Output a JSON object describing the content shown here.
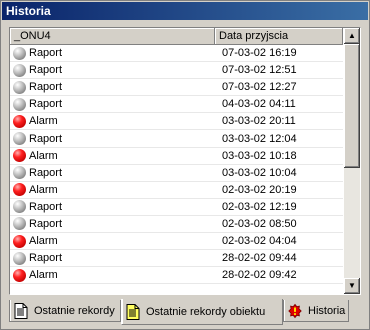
{
  "window": {
    "title": "Historia"
  },
  "columns": [
    "_ONU4",
    "Data przyjscia"
  ],
  "rows": [
    {
      "status": "gray",
      "type": "Raport",
      "date": "07-03-02 16:19"
    },
    {
      "status": "gray",
      "type": "Raport",
      "date": "07-03-02 12:51"
    },
    {
      "status": "gray",
      "type": "Raport",
      "date": "07-03-02 12:27"
    },
    {
      "status": "gray",
      "type": "Raport",
      "date": "04-03-02 04:11"
    },
    {
      "status": "red",
      "type": "Alarm",
      "date": "03-03-02 20:11"
    },
    {
      "status": "gray",
      "type": "Raport",
      "date": "03-03-02 12:04"
    },
    {
      "status": "red",
      "type": "Alarm",
      "date": "03-03-02 10:18"
    },
    {
      "status": "gray",
      "type": "Raport",
      "date": "03-03-02 10:04"
    },
    {
      "status": "red",
      "type": "Alarm",
      "date": "02-03-02 20:19"
    },
    {
      "status": "gray",
      "type": "Raport",
      "date": "02-03-02 12:19"
    },
    {
      "status": "gray",
      "type": "Raport",
      "date": "02-03-02 08:50"
    },
    {
      "status": "red",
      "type": "Alarm",
      "date": "02-03-02 04:04"
    },
    {
      "status": "gray",
      "type": "Raport",
      "date": "28-02-02 09:44"
    },
    {
      "status": "red",
      "type": "Alarm",
      "date": "28-02-02 09:42"
    }
  ],
  "tabs": [
    {
      "label": "Ostatnie rekordy",
      "icon": "document-icon"
    },
    {
      "label": "Ostatnie rekordy obiektu",
      "icon": "document-icon"
    },
    {
      "label": "Historia",
      "icon": "alarm-icon"
    }
  ],
  "scrollbar": {
    "up": "▲",
    "down": "▼"
  },
  "colors": {
    "title_start": "#0a246a",
    "title_end": "#3a6ea5",
    "alarm": "#e00000",
    "report": "#a0a0a0"
  }
}
